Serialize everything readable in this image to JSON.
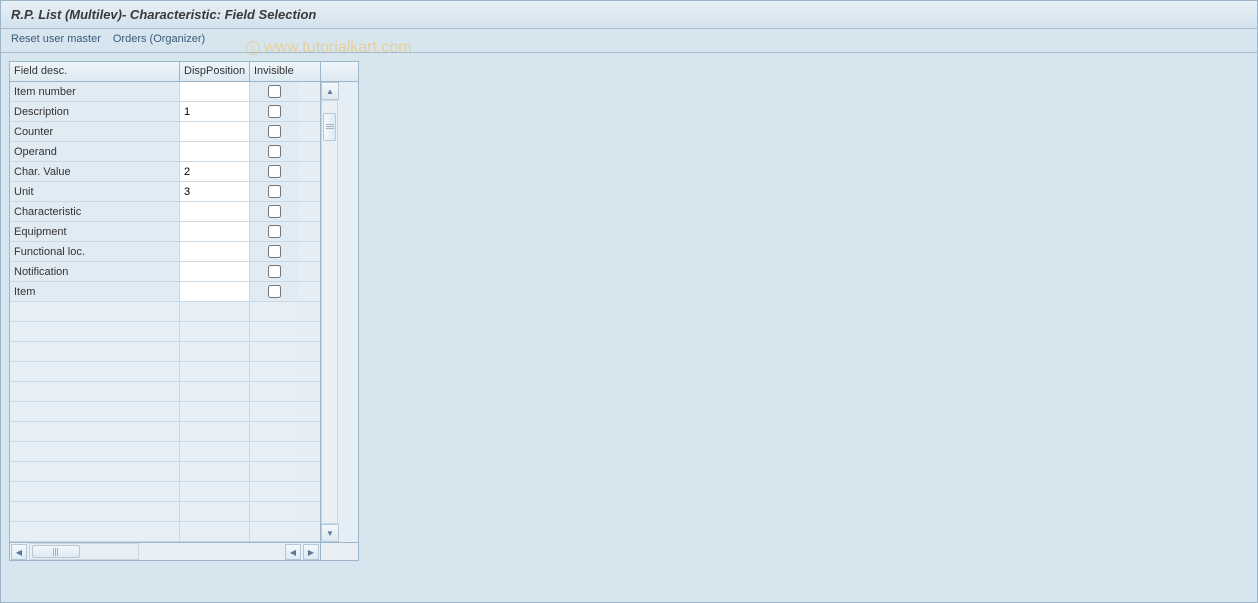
{
  "header": {
    "title": "R.P. List (Multilev)- Characteristic: Field Selection"
  },
  "toolbar": {
    "reset_label": "Reset user master",
    "orders_label": "Orders (Organizer)"
  },
  "table": {
    "columns": {
      "field_desc": "Field desc.",
      "disp_position": "DispPosition",
      "invisible": "Invisible"
    },
    "rows": [
      {
        "field": "Item number",
        "pos": "",
        "invisible": false
      },
      {
        "field": "Description",
        "pos": "1",
        "invisible": false
      },
      {
        "field": "Counter",
        "pos": "",
        "invisible": false
      },
      {
        "field": "Operand",
        "pos": "",
        "invisible": false
      },
      {
        "field": "Char. Value",
        "pos": "2",
        "invisible": false
      },
      {
        "field": "Unit",
        "pos": "3",
        "invisible": false
      },
      {
        "field": "Characteristic",
        "pos": "",
        "invisible": false
      },
      {
        "field": "Equipment",
        "pos": "",
        "invisible": false
      },
      {
        "field": "Functional loc.",
        "pos": "",
        "invisible": false
      },
      {
        "field": "Notification",
        "pos": "",
        "invisible": false
      },
      {
        "field": "Item",
        "pos": "",
        "invisible": false
      }
    ],
    "empty_rows_count": 12
  },
  "watermark": {
    "text": "www.tutorialkart.com"
  },
  "icons": {
    "settings": "table-settings-icon",
    "up": "▲",
    "down": "▼",
    "left": "◀",
    "right": "▶"
  }
}
